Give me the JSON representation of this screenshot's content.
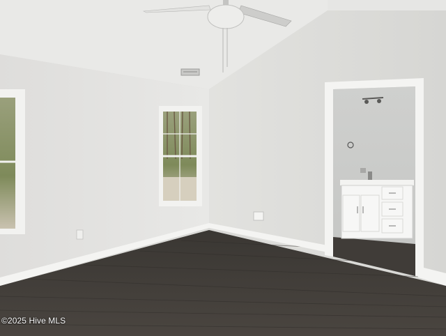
{
  "photo": {
    "subject": "empty-bedroom-with-ensuite-bathroom",
    "watermark": "©2025 Hive MLS"
  },
  "colors": {
    "wall_left": "#e4e4e1",
    "wall_right": "#dcdcd9",
    "ceiling": "#e9e9e7",
    "floor": "#44403c",
    "trim": "#f4f4f2",
    "vanity": "#f6f6f5"
  }
}
